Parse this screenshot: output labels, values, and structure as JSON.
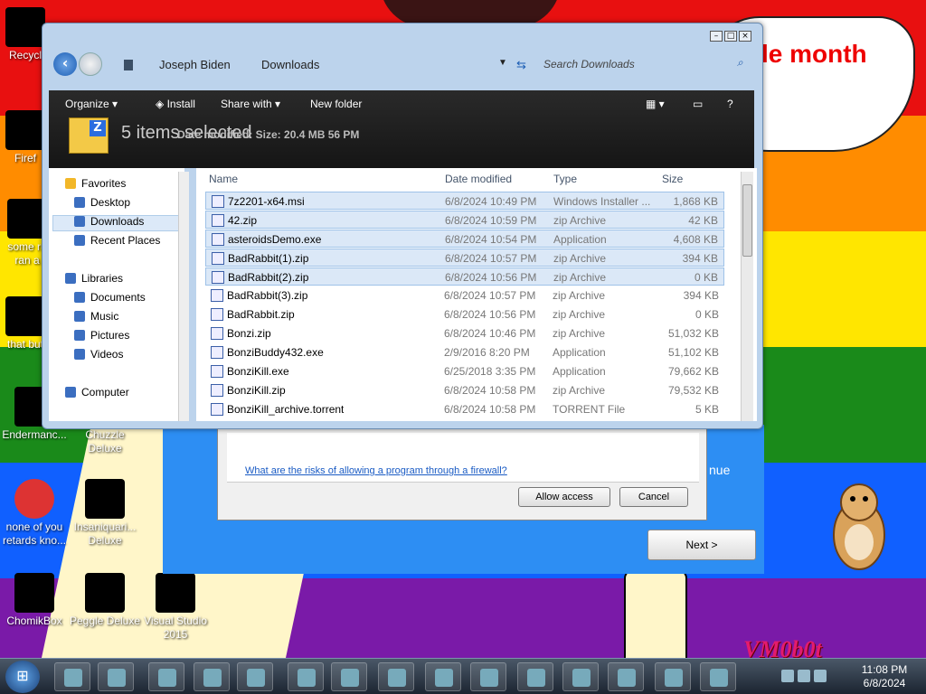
{
  "desktop": {
    "speech_text": "le month",
    "watermark": "VM0b0t",
    "icons": [
      {
        "label": "Recycl"
      },
      {
        "label": "Firef"
      },
      {
        "label": "some ru\nran a"
      },
      {
        "label": "that but"
      },
      {
        "label": "Endermanc..."
      },
      {
        "label": "Chuzzle\nDeluxe"
      },
      {
        "label": "none of you\nretards kno..."
      },
      {
        "label": "Insaniquari...\nDeluxe"
      },
      {
        "label": "ChomikBox"
      },
      {
        "label": "Peggle Deluxe"
      },
      {
        "label": "Visual Studio\n2015"
      }
    ]
  },
  "explorer": {
    "controls": {
      "minimize": "–",
      "maximize": "□",
      "close": "×"
    },
    "breadcrumb": [
      "Joseph Biden",
      "Downloads"
    ],
    "search_placeholder": "Search Downloads",
    "toolbar": {
      "organize": "Organize",
      "install": "Install",
      "share_with": "Share with",
      "new_folder": "New folder"
    },
    "details": {
      "selection": "5 items selected",
      "meta": "Date modified: Size: 20.4 MB 56 PM"
    },
    "nav": {
      "favorites": "Favorites",
      "desktop": "Desktop",
      "downloads": "Downloads",
      "recent": "Recent Places",
      "libraries": "Libraries",
      "documents": "Documents",
      "music": "Music",
      "pictures": "Pictures",
      "videos": "Videos",
      "computer": "Computer"
    },
    "columns": {
      "name": "Name",
      "date": "Date modified",
      "type": "Type",
      "size": "Size"
    },
    "files": [
      {
        "name": "7z2201-x64.msi",
        "date": "6/8/2024 10:49 PM",
        "type": "Windows Installer ...",
        "size": "1,868 KB",
        "selected": true
      },
      {
        "name": "42.zip",
        "date": "6/8/2024 10:59 PM",
        "type": "zip Archive",
        "size": "42 KB",
        "selected": true
      },
      {
        "name": "asteroidsDemo.exe",
        "date": "6/8/2024 10:54 PM",
        "type": "Application",
        "size": "4,608 KB",
        "selected": true
      },
      {
        "name": "BadRabbit(1).zip",
        "date": "6/8/2024 10:57 PM",
        "type": "zip Archive",
        "size": "394 KB",
        "selected": true
      },
      {
        "name": "BadRabbit(2).zip",
        "date": "6/8/2024 10:56 PM",
        "type": "zip Archive",
        "size": "0 KB",
        "selected": true
      },
      {
        "name": "BadRabbit(3).zip",
        "date": "6/8/2024 10:57 PM",
        "type": "zip Archive",
        "size": "394 KB",
        "selected": false
      },
      {
        "name": "BadRabbit.zip",
        "date": "6/8/2024 10:56 PM",
        "type": "zip Archive",
        "size": "0 KB",
        "selected": false
      },
      {
        "name": "Bonzi.zip",
        "date": "6/8/2024 10:46 PM",
        "type": "zip Archive",
        "size": "51,032 KB",
        "selected": false
      },
      {
        "name": "BonziBuddy432.exe",
        "date": "2/9/2016 8:20 PM",
        "type": "Application",
        "size": "51,102 KB",
        "selected": false
      },
      {
        "name": "BonziKill.exe",
        "date": "6/25/2018 3:35 PM",
        "type": "Application",
        "size": "79,662 KB",
        "selected": false
      },
      {
        "name": "BonziKill.zip",
        "date": "6/8/2024 10:58 PM",
        "type": "zip Archive",
        "size": "79,532 KB",
        "selected": false
      },
      {
        "name": "BonziKill_archive.torrent",
        "date": "6/8/2024 10:58 PM",
        "type": "TORRENT File",
        "size": "5 KB",
        "selected": false
      }
    ]
  },
  "firewall": {
    "link": "What are the risks of allowing a program through a firewall?",
    "allow": "Allow access",
    "cancel": "Cancel"
  },
  "wizard": {
    "next": "Next >",
    "side_label": "nue"
  },
  "taskbar": {
    "start": "⊞",
    "time": "11:08 PM",
    "date": "6/8/2024"
  }
}
